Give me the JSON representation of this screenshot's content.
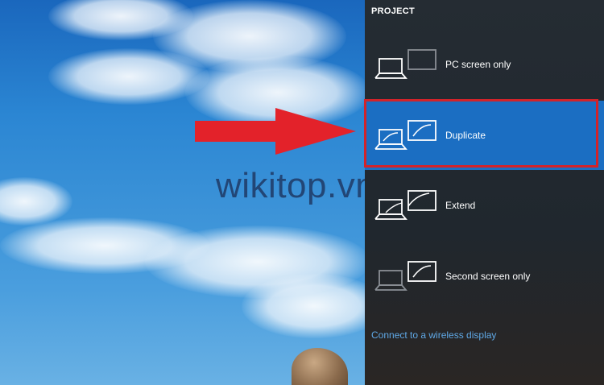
{
  "project_panel": {
    "title": "PROJECT",
    "options": [
      {
        "label": "PC screen only",
        "icon": "pc-screen-only-icon",
        "selected": false
      },
      {
        "label": "Duplicate",
        "icon": "duplicate-icon",
        "selected": true
      },
      {
        "label": "Extend",
        "icon": "extend-icon",
        "selected": false
      },
      {
        "label": "Second screen only",
        "icon": "second-screen-only-icon",
        "selected": false
      }
    ],
    "wireless_link": "Connect to a wireless display"
  },
  "watermark": "wikitop.vn",
  "colors": {
    "panel_bg": "#232a31",
    "selected_bg": "#1b6ec2",
    "highlight_border": "#d2232a",
    "arrow": "#e3222a",
    "link": "#5fa8e6"
  }
}
